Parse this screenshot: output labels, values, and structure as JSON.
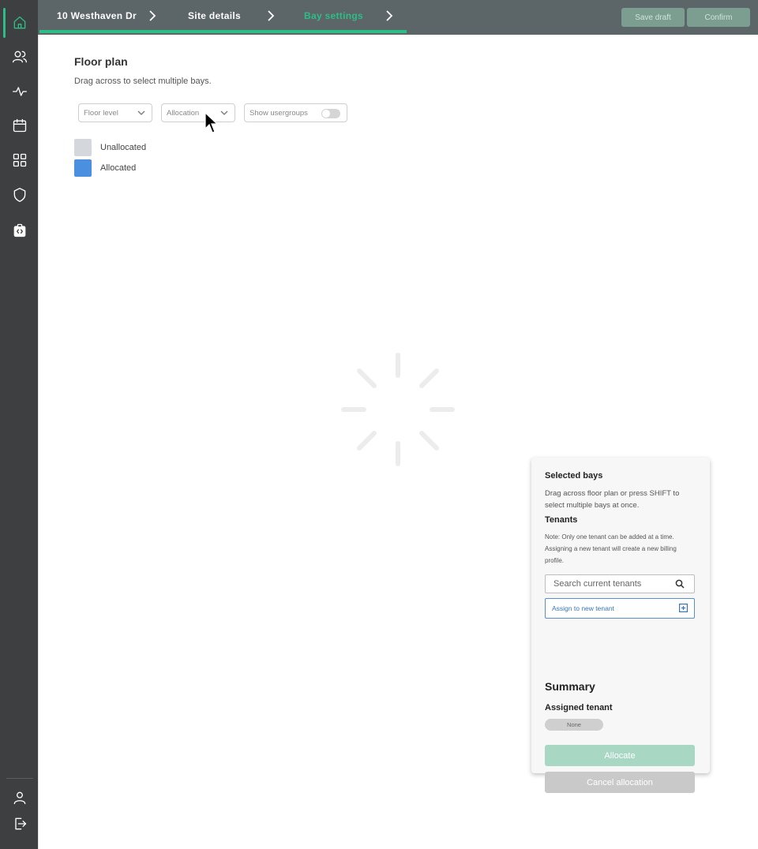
{
  "breadcrumbs": [
    {
      "label": "10 Westhaven Dr"
    },
    {
      "label": "Site details"
    },
    {
      "label": "Bay settings"
    }
  ],
  "actions": {
    "save_draft": "Save draft",
    "confirm": "Confirm"
  },
  "progress": {
    "percent": 51
  },
  "sidebar": {
    "icons": [
      "home-icon",
      "users-icon",
      "activity-icon",
      "calendar-icon",
      "grid-icon",
      "shield-icon",
      "badge-code-icon"
    ],
    "bottom_icons": [
      "profile-icon",
      "logout-icon"
    ],
    "active_item": "home-icon"
  },
  "floor_plan": {
    "title": "Floor plan",
    "subtitle": "Drag across to select multiple bays.",
    "filters": {
      "floor_level": "Floor level",
      "allocation": "Allocation",
      "show_usergroups": "Show usergroups"
    },
    "usergroups_toggle_on": false,
    "legend": [
      {
        "label": "Unallocated",
        "color": "#d4d7dc"
      },
      {
        "label": "Allocated",
        "color": "#4a8fe0"
      }
    ]
  },
  "panel": {
    "selected_title": "Selected bays",
    "selected_desc": "Drag across floor plan or press SHIFT to select multiple bays at once.",
    "tenants_title": "Tenants",
    "tenants_note": "Note: Only one tenant can be added at a time. Assigning a new tenant will create a new billing profile.",
    "search_placeholder": "Search current tenants",
    "assign_label": "Assign to new tenant",
    "summary_title": "Summary",
    "assigned_title": "Assigned tenant",
    "assigned_value": "None",
    "allocate_label": "Allocate",
    "cancel_label": "Cancel allocation"
  },
  "colors": {
    "accent": "#2ebd85",
    "sidebar": "#3d3f41",
    "topbar": "#5c6567",
    "allocate": "#a8d8c4",
    "cancel": "#c9c9c9"
  }
}
